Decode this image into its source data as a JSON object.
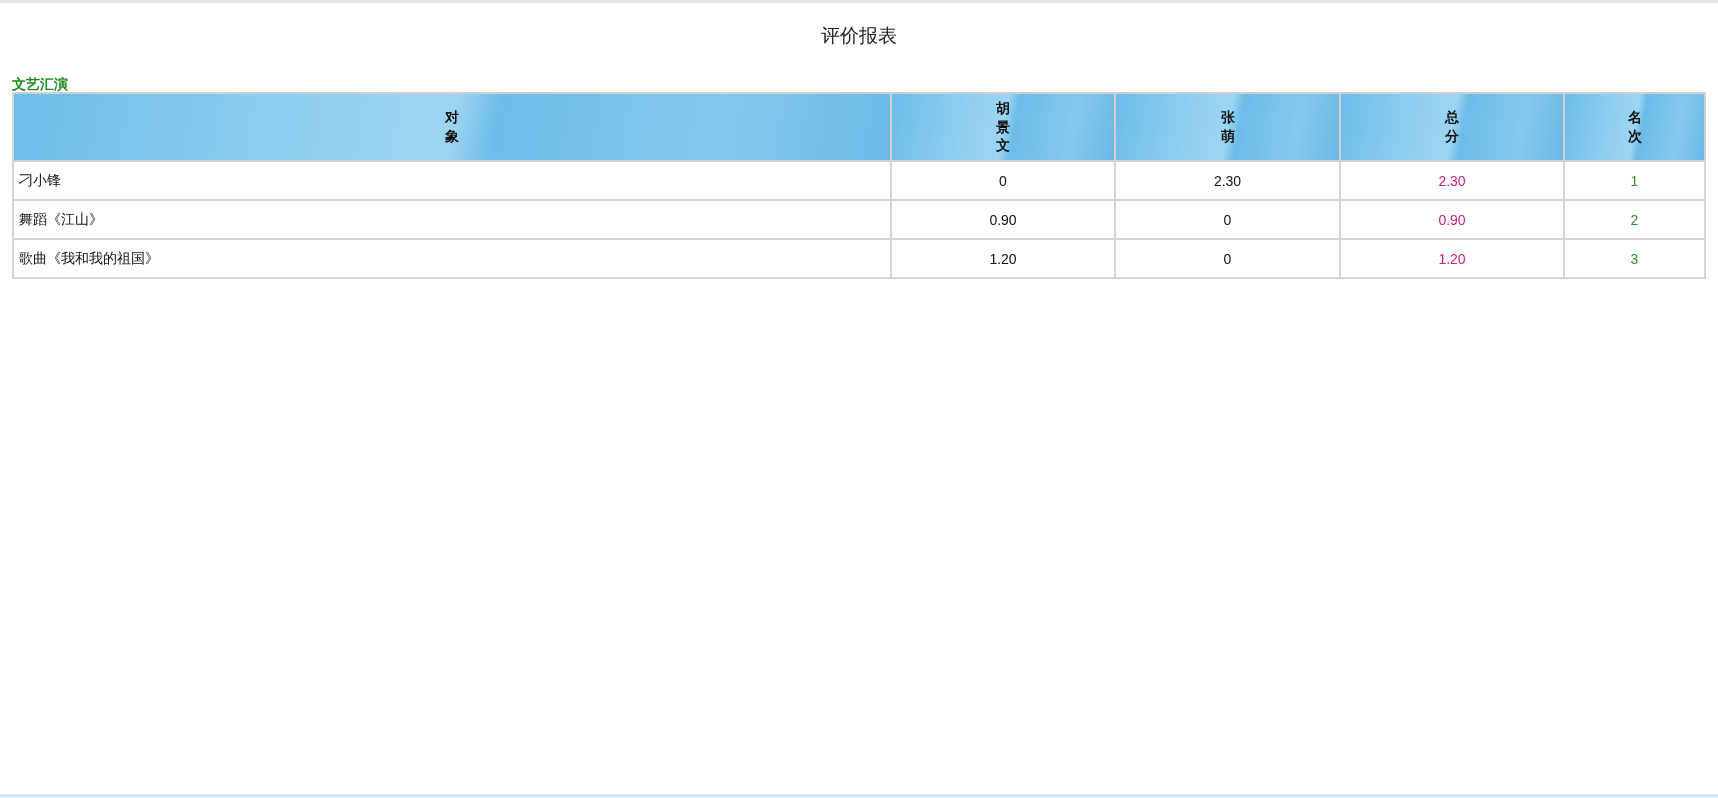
{
  "title": "评价报表",
  "section": "文艺汇演",
  "table": {
    "columns": [
      {
        "label": "对象",
        "kind": "name"
      },
      {
        "label": "胡景文",
        "kind": "score"
      },
      {
        "label": "张萌",
        "kind": "score"
      },
      {
        "label": "总分",
        "kind": "total"
      },
      {
        "label": "名次",
        "kind": "rank"
      }
    ],
    "rows": [
      [
        "刁小锋",
        "0",
        "2.30",
        "2.30",
        "1"
      ],
      [
        "舞蹈《江山》",
        "0.90",
        "0",
        "0.90",
        "2"
      ],
      [
        "歌曲《我和我的祖国》",
        "1.20",
        "0",
        "1.20",
        "3"
      ]
    ]
  }
}
